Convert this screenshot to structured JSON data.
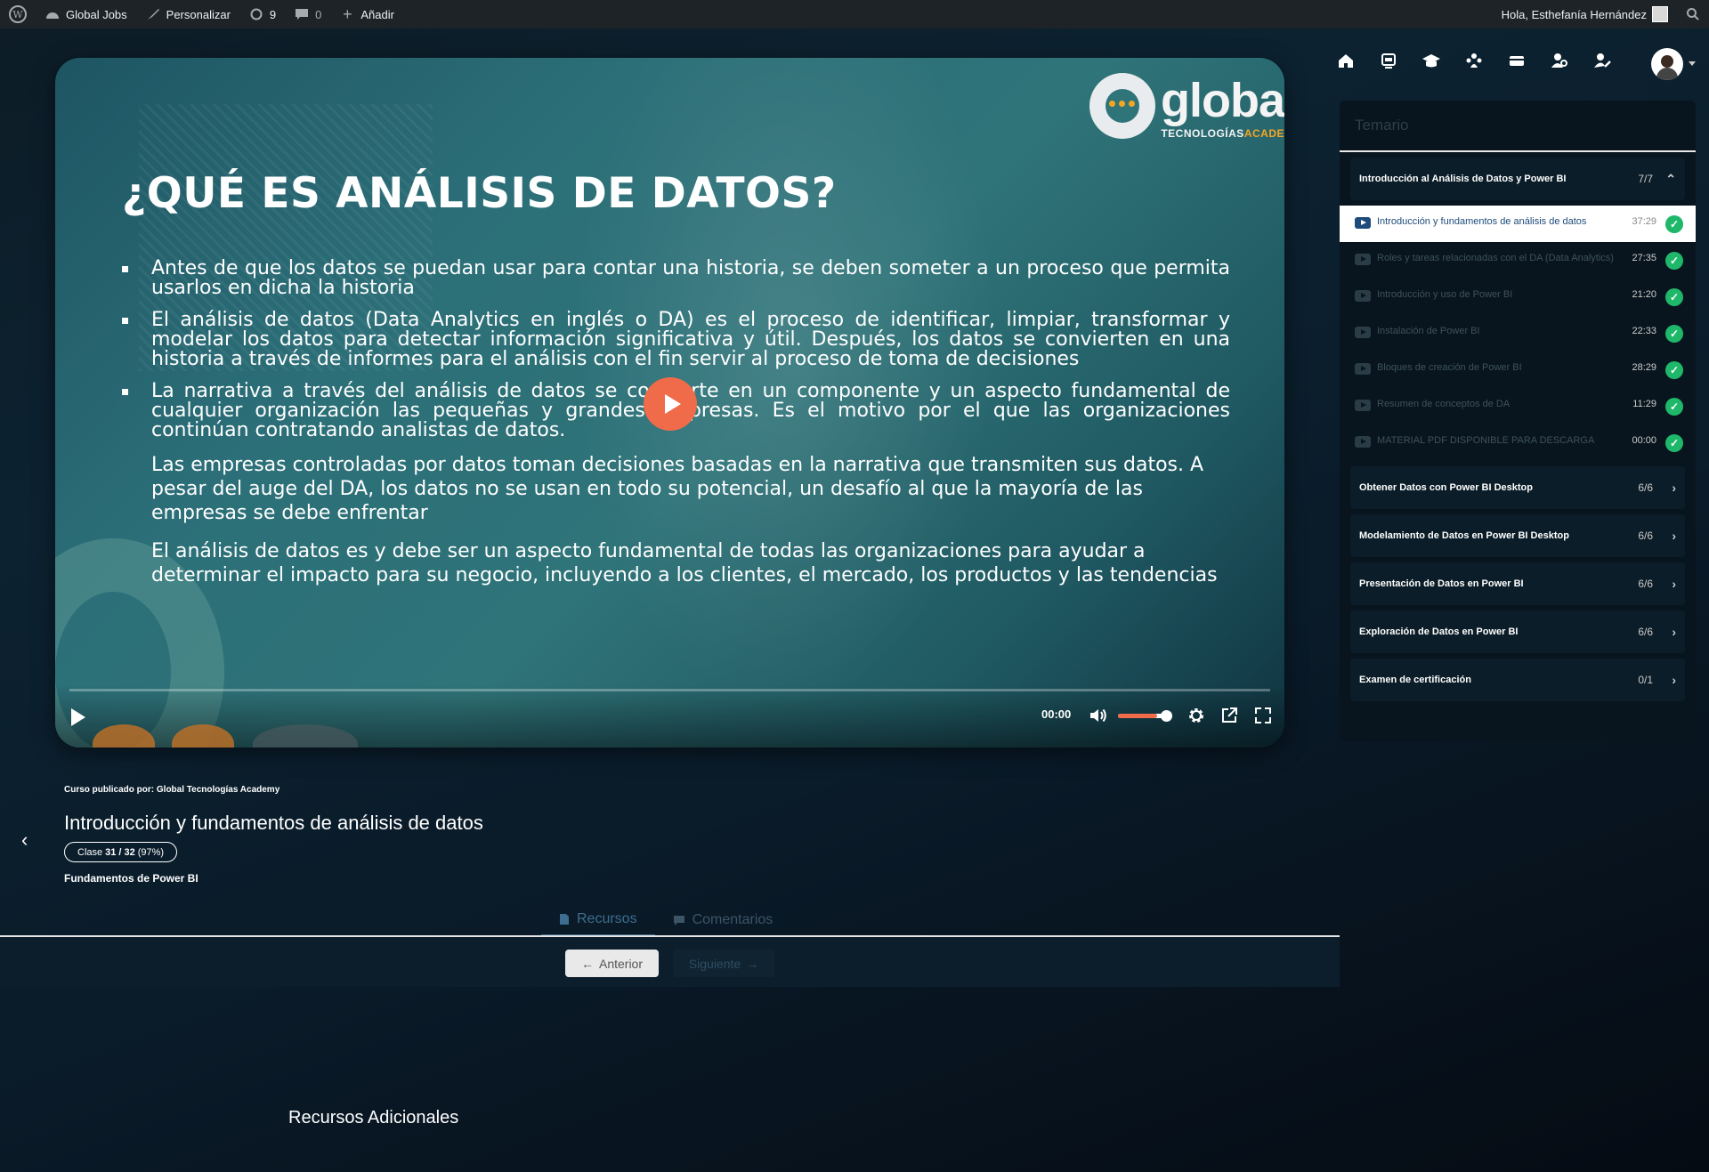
{
  "adminbar": {
    "site": "Global Jobs",
    "customize": "Personalizar",
    "updates": "9",
    "comments": "0",
    "add": "Añadir",
    "greeting": "Hola, Esthefanía Hernández"
  },
  "slide": {
    "title": "¿QUÉ ES ANÁLISIS DE DATOS?",
    "logo_text": "globa",
    "logo_sub1": "TECNOLOGÍAS",
    "logo_sub2": "ACADE",
    "bullet1": "Antes de que los datos se puedan usar para contar una historia, se deben someter a un proceso que permita usarlos en dicha la historia",
    "bullet2": "El análisis de datos (Data Analytics en inglés o DA) es el proceso de identificar, limpiar, transformar y modelar los datos para detectar información significativa y útil. Después, los datos se convierten en una historia a través de informes para el análisis con el fin servir al proceso de toma de decisiones",
    "bullet3": "La narrativa a través del análisis de datos se convierte en un componente y un aspecto fundamental de cualquier organización las pequeñas y grandes empresas. Es el motivo por el que las organizaciones continúan contratando analistas de datos.",
    "para1": "Las empresas controladas por datos toman decisiones basadas en la narrativa que transmiten sus datos. A pesar del auge del DA, los datos no se usan en todo su potencial, un desafío al que la mayoría de las empresas se debe enfrentar",
    "para2": "El análisis de datos es y debe ser un aspecto fundamental de todas las organizaciones para ayudar a determinar el impacto para su negocio, incluyendo a los clientes, el mercado, los productos y las tendencias"
  },
  "player": {
    "time": "00:00",
    "progress": 0,
    "volume": 0.8
  },
  "sidebar": {
    "header": "Temario",
    "sections": [
      {
        "title": "Introducción al Análisis de Datos y Power BI",
        "count": "7/7"
      },
      {
        "title": "Obtener Datos con Power BI Desktop",
        "count": "6/6"
      },
      {
        "title": "Modelamiento de Datos en Power BI Desktop",
        "count": "6/6"
      },
      {
        "title": "Presentación de Datos en Power BI",
        "count": "6/6"
      },
      {
        "title": "Exploración de Datos en Power BI",
        "count": "6/6"
      },
      {
        "title": "Examen de certificación",
        "count": "0/1"
      }
    ],
    "lessons": [
      {
        "title": "Introducción y fundamentos de análisis de datos",
        "duration": "37:29"
      },
      {
        "title": "Roles y tareas relacionadas con el DA (Data Analytics)",
        "duration": "27:35"
      },
      {
        "title": "Introducción y uso de Power BI",
        "duration": "21:20"
      },
      {
        "title": "Instalación de Power BI",
        "duration": "22:33"
      },
      {
        "title": "Bloques de creación de Power BI",
        "duration": "28:29"
      },
      {
        "title": "Resumen de conceptos de DA",
        "duration": "11:29"
      },
      {
        "title": "MATERIAL PDF DISPONIBLE PARA DESCARGA",
        "duration": "00:00"
      }
    ]
  },
  "course": {
    "published_by": "Curso publicado por: Global Tecnologías Academy",
    "lesson_title": "Introducción y fundamentos de análisis de datos",
    "class_label": "Clase",
    "class_current": "31",
    "class_total": "/ 32",
    "class_pct": "(97%)",
    "course_name": "Fundamentos de Power BI"
  },
  "tabs": {
    "resources": "Recursos",
    "comments": "Comentarios"
  },
  "nav": {
    "prev": "Anterior",
    "next": "Siguiente"
  },
  "extra_heading": "Recursos Adicionales",
  "colors": {
    "accent": "#f06b4a",
    "success": "#1fb86a",
    "admin_bar": "#1d2327"
  }
}
